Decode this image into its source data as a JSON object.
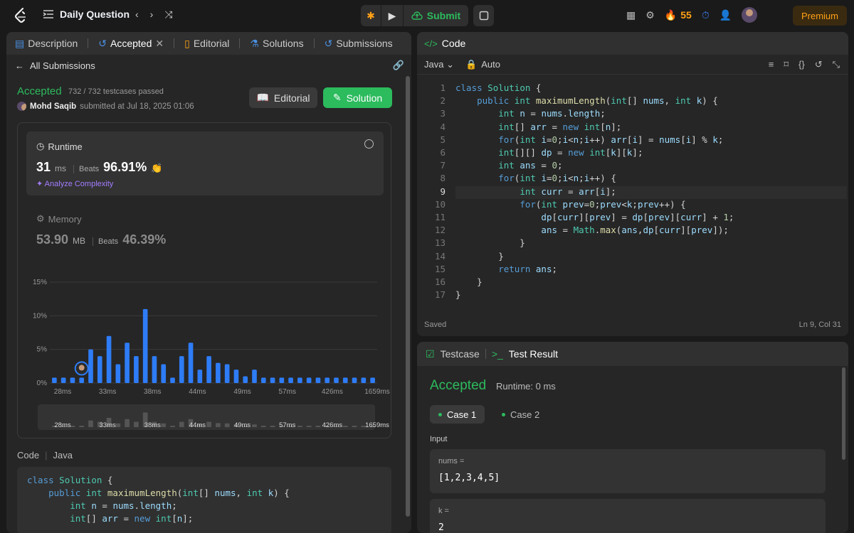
{
  "topbar": {
    "title": "Daily Question",
    "submit_label": "Submit",
    "streak_count": "55",
    "premium_label": "Premium"
  },
  "left_tabs": [
    {
      "label": "Description"
    },
    {
      "label": "Accepted"
    },
    {
      "label": "Editorial"
    },
    {
      "label": "Solutions"
    },
    {
      "label": "Submissions"
    }
  ],
  "submission": {
    "back_label": "All Submissions",
    "status": "Accepted",
    "testcases": "732 / 732 testcases passed",
    "author": "Mohd Saqib",
    "submitted_at": "submitted at Jul 18, 2025 01:06",
    "editorial_btn": "Editorial",
    "solution_btn": "Solution"
  },
  "runtime": {
    "title": "Runtime",
    "value": "31",
    "unit": "ms",
    "beats_label": "Beats",
    "beats_value": "96.91%",
    "analyze_label": "Analyze Complexity"
  },
  "memory": {
    "title": "Memory",
    "value": "53.90",
    "unit": "MB",
    "beats_label": "Beats",
    "beats_value": "46.39%"
  },
  "chart_data": {
    "type": "bar",
    "y_ticks": [
      "15%",
      "10%",
      "5%",
      "0%"
    ],
    "ylim": [
      0,
      15
    ],
    "x_tick_labels": [
      "28ms",
      "33ms",
      "38ms",
      "44ms",
      "49ms",
      "57ms",
      "426ms",
      "1659ms"
    ],
    "values": [
      0.8,
      0.8,
      0.8,
      0.8,
      5.0,
      4.0,
      7.0,
      2.8,
      6.0,
      4.0,
      11.0,
      4.0,
      2.8,
      0.8,
      4.0,
      6.0,
      2.0,
      4.0,
      3.0,
      2.8,
      2.0,
      1.0,
      2.0,
      0.8,
      0.8,
      0.8,
      0.8,
      0.8,
      0.8,
      0.8,
      0.8,
      0.8,
      0.8,
      0.8,
      0.8,
      0.8
    ],
    "highlight_index": 3,
    "bar_color": "#2e7cf6"
  },
  "code_section": {
    "label": "Code",
    "lang": "Java",
    "preview_lines": [
      "class Solution {",
      "    public int maximumLength(int[] nums, int k) {",
      "        int n = nums.length;",
      "        int[] arr = new int[n];"
    ]
  },
  "editor": {
    "title": "Code",
    "language": "Java",
    "mode": "Auto",
    "status_saved": "Saved",
    "cursor_pos": "Ln 9, Col 31",
    "current_line": 9,
    "lines": [
      "class Solution {",
      "    public int maximumLength(int[] nums, int k) {",
      "        int n = nums.length;",
      "        int[] arr = new int[n];",
      "        for(int i=0;i<n;i++) arr[i] = nums[i] % k;",
      "        int[][] dp = new int[k][k];",
      "        int ans = 0;",
      "        for(int i=0;i<n;i++) {",
      "            int curr = arr[i];",
      "            for(int prev=0;prev<k;prev++) {",
      "                dp[curr][prev] = dp[prev][curr] + 1;",
      "                ans = Math.max(ans,dp[curr][prev]);",
      "            }",
      "        }",
      "        return ans;",
      "    }",
      "}"
    ]
  },
  "result": {
    "tab_testcase": "Testcase",
    "tab_result": "Test Result",
    "status": "Accepted",
    "runtime": "Runtime: 0 ms",
    "case1": "Case 1",
    "case2": "Case 2",
    "input_label": "Input",
    "input1_name": "nums =",
    "input1_value": "[1,2,3,4,5]",
    "input2_name": "k =",
    "input2_value": "2"
  },
  "colors": {
    "accent_green": "#2cbb5d",
    "brand_orange": "#ffa116",
    "bar_blue": "#2e7cf6"
  }
}
